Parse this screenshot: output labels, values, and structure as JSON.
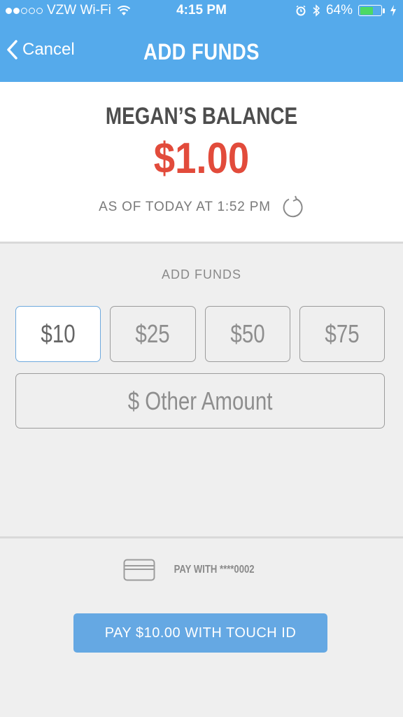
{
  "status_bar": {
    "carrier": "VZW Wi-Fi",
    "time": "4:15 PM",
    "battery": "64%",
    "battery_level": 0.64,
    "signal_strength": 2,
    "signal_total": 5
  },
  "nav": {
    "back_label": "Cancel",
    "title": "ADD FUNDS"
  },
  "balance": {
    "title": "MEGAN’S BALANCE",
    "amount": "$1.00",
    "as_of": "AS OF TODAY AT 1:52 PM"
  },
  "add_funds": {
    "label": "ADD FUNDS",
    "amounts": [
      "$10",
      "$25",
      "$50",
      "$75"
    ],
    "selected": "$10",
    "other_label": "$ Other Amount"
  },
  "payment": {
    "pay_with": "PAY WITH ****0002",
    "button_label": "PAY $10.00 WITH TOUCH ID"
  },
  "colors": {
    "header": "#55aaeb",
    "balance_amount": "#e24b3b",
    "pay_button": "#65a8e3",
    "battery": "#4cd964"
  }
}
